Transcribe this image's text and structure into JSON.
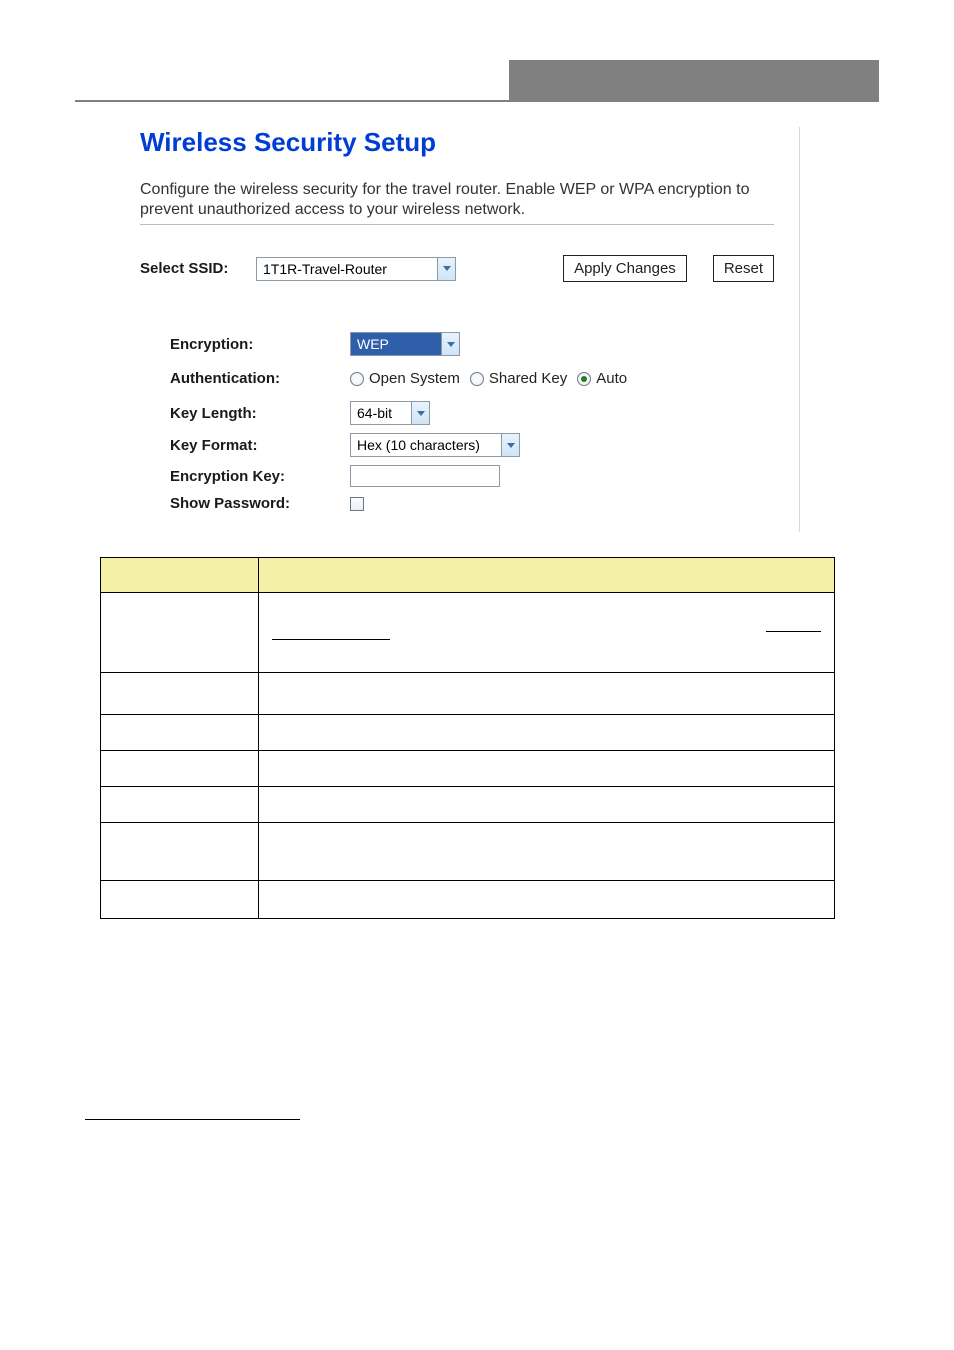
{
  "header": {
    "title": "Wireless Security Setup",
    "description": "Configure the wireless security for the travel router. Enable WEP or WPA encryption to prevent unauthorized access to your wireless network."
  },
  "ssid_row": {
    "label": "Select SSID:",
    "value": "1T1R-Travel-Router",
    "apply_label": "Apply Changes",
    "reset_label": "Reset"
  },
  "form": {
    "encryption": {
      "label": "Encryption:",
      "value": "WEP"
    },
    "authentication": {
      "label": "Authentication:",
      "options": [
        "Open System",
        "Shared Key",
        "Auto"
      ],
      "selected": "Auto"
    },
    "key_length": {
      "label": "Key Length:",
      "value": "64-bit"
    },
    "key_format": {
      "label": "Key Format:",
      "value": "Hex (10 characters)"
    },
    "encryption_key": {
      "label": "Encryption Key:",
      "value": ""
    },
    "show_password": {
      "label": "Show Password:",
      "checked": false
    }
  }
}
